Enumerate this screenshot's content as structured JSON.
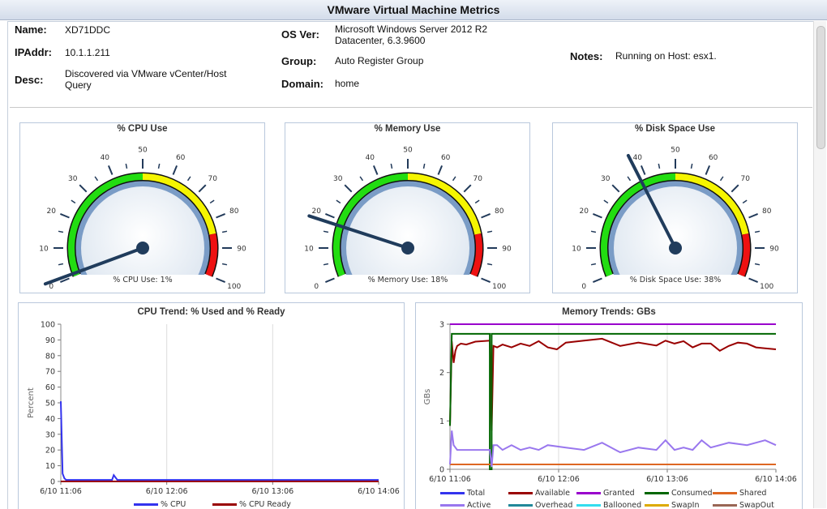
{
  "window": {
    "title": "VMware Virtual Machine Metrics"
  },
  "info": {
    "name_label": "Name:",
    "name_value": "XD71DDC",
    "ip_label": "IPAddr:",
    "ip_value": "10.1.1.211",
    "desc_label": "Desc:",
    "desc_line1": "Discovered via VMware vCenter/Host",
    "desc_line2": "Query",
    "os_label": "OS Ver:",
    "os_line1": "Microsoft Windows Server 2012 R2",
    "os_line2": "Datacenter, 6.3.9600",
    "group_label": "Group:",
    "group_value": "Auto Register Group",
    "domain_label": "Domain:",
    "domain_value": "home",
    "notes_label": "Notes:",
    "notes_value": "Running on Host: esx1."
  },
  "gauges": [
    {
      "title": "% CPU Use",
      "value": 1,
      "readout": "% CPU Use: 1%"
    },
    {
      "title": "% Memory Use",
      "value": 18,
      "readout": "% Memory Use: 18%"
    },
    {
      "title": "% Disk Space Use",
      "value": 38,
      "readout": "% Disk Space Use: 38%"
    }
  ],
  "gauge_scale": {
    "min": 0,
    "max": 100,
    "tick_labels": [
      "0",
      "10",
      "20",
      "30",
      "40",
      "50",
      "60",
      "70",
      "80",
      "90",
      "100"
    ],
    "bands": [
      {
        "from": 0,
        "to": 50,
        "color": "#22dd11"
      },
      {
        "from": 50,
        "to": 85,
        "color": "#f5f500"
      },
      {
        "from": 85,
        "to": 100,
        "color": "#ee1111"
      }
    ]
  },
  "chart_data": [
    {
      "type": "line",
      "title": "CPU Trend: % Used and % Ready",
      "ylabel": "Percent",
      "ylim": [
        0,
        100
      ],
      "yticks": [
        "0",
        "10",
        "20",
        "30",
        "40",
        "50",
        "60",
        "70",
        "80",
        "90",
        "100"
      ],
      "xticks": [
        "6/10 11:06",
        "6/10 12:06",
        "6/10 13:06",
        "6/10 14:06"
      ],
      "grid": true,
      "legend_position": "bottom",
      "series": [
        {
          "name": "% CPU",
          "color": "#3333ee",
          "x": [
            "11:06",
            "11:07",
            "11:08",
            "11:09",
            "11:12",
            "11:20",
            "11:30",
            "11:35",
            "11:36",
            "11:38",
            "11:45",
            "12:00",
            "12:20",
            "12:40",
            "13:00",
            "13:10",
            "13:20",
            "13:40",
            "14:06"
          ],
          "values": [
            51,
            5,
            2,
            1,
            1,
            1,
            1,
            1,
            4,
            1,
            1,
            1,
            1,
            1,
            1,
            1,
            1,
            1,
            1
          ]
        },
        {
          "name": "% CPU Ready",
          "color": "#990000",
          "x": [
            "11:06",
            "14:06"
          ],
          "values": [
            0,
            0
          ]
        }
      ]
    },
    {
      "type": "line",
      "title": "Memory Trends: GBs",
      "ylabel": "GBs",
      "ylim": [
        0,
        3
      ],
      "yticks": [
        "0",
        "1",
        "2",
        "3"
      ],
      "xticks": [
        "6/10 11:06",
        "6/10 12:06",
        "6/10 13:06",
        "6/10 14:06"
      ],
      "grid": true,
      "legend_position": "bottom",
      "series": [
        {
          "name": "Total",
          "color": "#3333ee",
          "x": [],
          "values": []
        },
        {
          "name": "Available",
          "color": "#990000",
          "x": [
            "11:06",
            "11:07",
            "11:08",
            "11:09",
            "11:10",
            "11:12",
            "11:15",
            "11:20",
            "11:28",
            "11:29",
            "11:30",
            "11:32",
            "11:35",
            "11:40",
            "11:45",
            "11:50",
            "11:55",
            "12:00",
            "12:05",
            "12:10",
            "12:20",
            "12:30",
            "12:40",
            "12:50",
            "13:00",
            "13:05",
            "13:10",
            "13:15",
            "13:20",
            "13:25",
            "13:30",
            "13:35",
            "13:40",
            "13:45",
            "13:50",
            "13:55",
            "14:00",
            "14:06"
          ],
          "values": [
            0.9,
            2.65,
            2.2,
            2.45,
            2.55,
            2.6,
            2.58,
            2.64,
            2.66,
            0.8,
            2.55,
            2.52,
            2.58,
            2.52,
            2.6,
            2.55,
            2.65,
            2.52,
            2.48,
            2.62,
            2.66,
            2.7,
            2.55,
            2.62,
            2.56,
            2.66,
            2.6,
            2.65,
            2.52,
            2.6,
            2.6,
            2.45,
            2.55,
            2.62,
            2.6,
            2.52,
            2.5,
            2.48
          ]
        },
        {
          "name": "Granted",
          "color": "#9900cc",
          "x": [
            "11:06",
            "14:06"
          ],
          "values": [
            3.0,
            3.0
          ]
        },
        {
          "name": "Consumed",
          "color": "#006600",
          "x": [
            "11:06",
            "11:07",
            "11:28",
            "11:28",
            "11:29",
            "11:29",
            "14:06"
          ],
          "values": [
            0.9,
            2.8,
            2.8,
            0.0,
            0.0,
            2.8,
            2.8
          ]
        },
        {
          "name": "Shared",
          "color": "#dd6622",
          "x": [
            "11:06",
            "14:06"
          ],
          "values": [
            0.1,
            0.1
          ]
        },
        {
          "name": "Active",
          "color": "#9977ee",
          "x": [
            "11:06",
            "11:07",
            "11:08",
            "11:10",
            "11:15",
            "11:20",
            "11:28",
            "11:29",
            "11:30",
            "11:32",
            "11:35",
            "11:40",
            "11:45",
            "11:50",
            "11:55",
            "12:00",
            "12:10",
            "12:20",
            "12:30",
            "12:40",
            "12:50",
            "13:00",
            "13:05",
            "13:10",
            "13:15",
            "13:20",
            "13:25",
            "13:30",
            "13:40",
            "13:50",
            "14:00",
            "14:06"
          ],
          "values": [
            0.1,
            0.8,
            0.5,
            0.4,
            0.4,
            0.4,
            0.4,
            0.05,
            0.5,
            0.5,
            0.4,
            0.5,
            0.4,
            0.45,
            0.4,
            0.5,
            0.45,
            0.4,
            0.55,
            0.35,
            0.45,
            0.4,
            0.6,
            0.4,
            0.45,
            0.4,
            0.6,
            0.45,
            0.55,
            0.5,
            0.6,
            0.5
          ]
        },
        {
          "name": "Overhead",
          "color": "#228899",
          "x": [],
          "values": []
        },
        {
          "name": "Ballooned",
          "color": "#33ddee",
          "x": [],
          "values": []
        },
        {
          "name": "SwapIn",
          "color": "#ddaa00",
          "x": [],
          "values": []
        },
        {
          "name": "SwapOut",
          "color": "#996655",
          "x": [],
          "values": []
        }
      ]
    }
  ]
}
